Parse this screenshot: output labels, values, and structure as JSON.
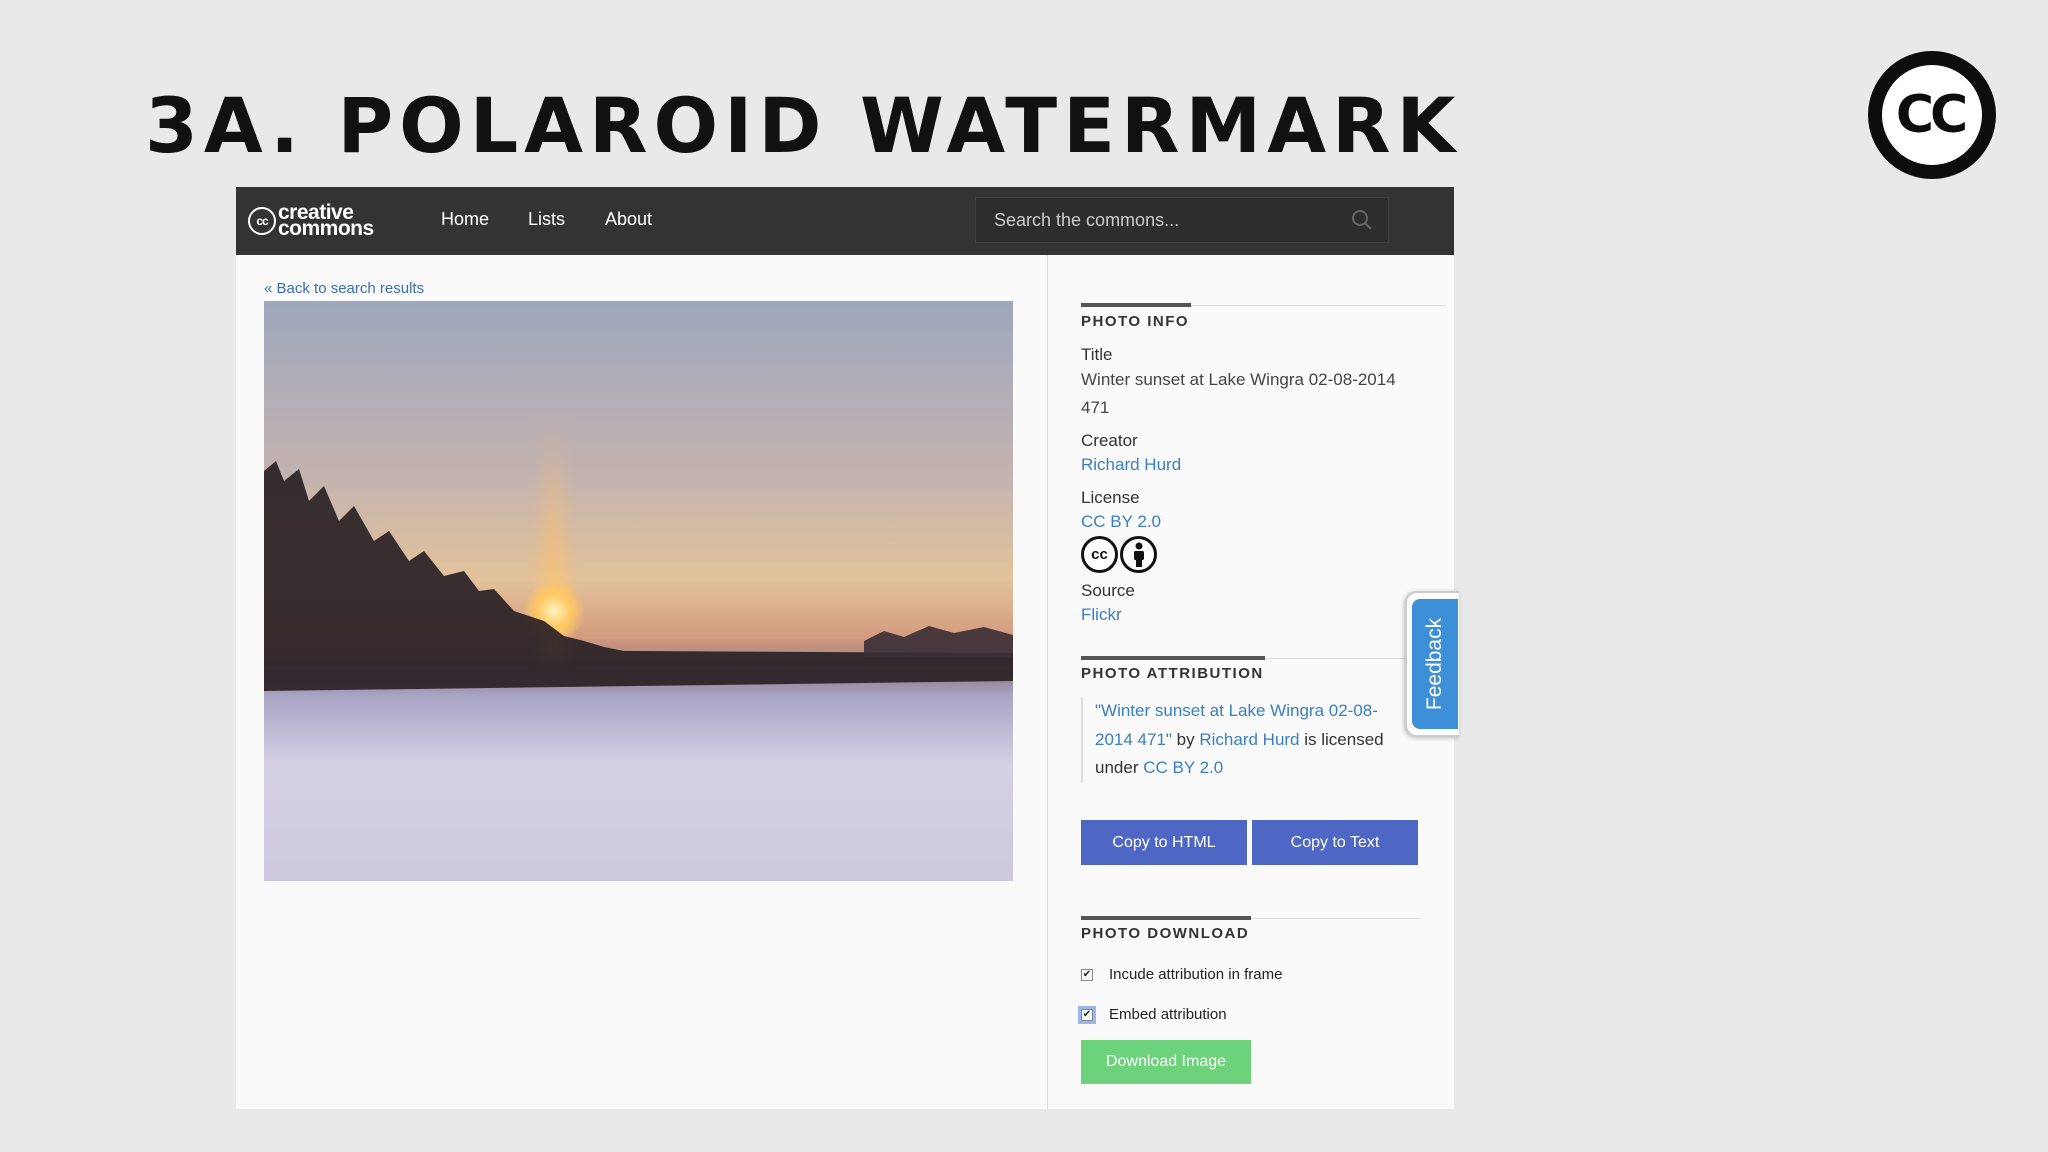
{
  "slide": {
    "title": "3A. POLAROID WATERMARK",
    "logo_text": "CC"
  },
  "navbar": {
    "brand_symbol": "cc",
    "brand_line1": "creative",
    "brand_line2": "commons",
    "links": [
      "Home",
      "Lists",
      "About"
    ],
    "search_placeholder": "Search the commons..."
  },
  "main": {
    "back_link": "« Back to search results"
  },
  "photo_info": {
    "heading": "PHOTO INFO",
    "title_label": "Title",
    "title_value": "Winter sunset at Lake Wingra 02-08-2014 471",
    "creator_label": "Creator",
    "creator_value": "Richard Hurd",
    "license_label": "License",
    "license_value": "CC BY 2.0",
    "license_icons": [
      "cc",
      "by"
    ],
    "source_label": "Source",
    "source_value": "Flickr"
  },
  "photo_attribution": {
    "heading": "PHOTO ATTRIBUTION",
    "title_link": "\"Winter sunset at Lake Wingra 02-08-2014 471\"",
    "by_text": " by ",
    "creator_link": "Richard Hurd",
    "licensed_text": " is licensed under ",
    "license_link": "CC BY 2.0",
    "copy_html_label": "Copy to HTML",
    "copy_text_label": "Copy to Text"
  },
  "photo_download": {
    "heading": "PHOTO DOWNLOAD",
    "checkbox1_label": "Incude attribution in frame",
    "checkbox1_checked": true,
    "checkbox2_label": "Embed attribution",
    "checkbox2_checked": true,
    "download_label": "Download Image"
  },
  "feedback": {
    "label": "Feedback"
  },
  "colors": {
    "navbar": "#333333",
    "link": "#3a7fc1",
    "primary_button": "#4f67c4",
    "download_button": "#6cd27c",
    "feedback_tab": "#3d8fd8"
  }
}
